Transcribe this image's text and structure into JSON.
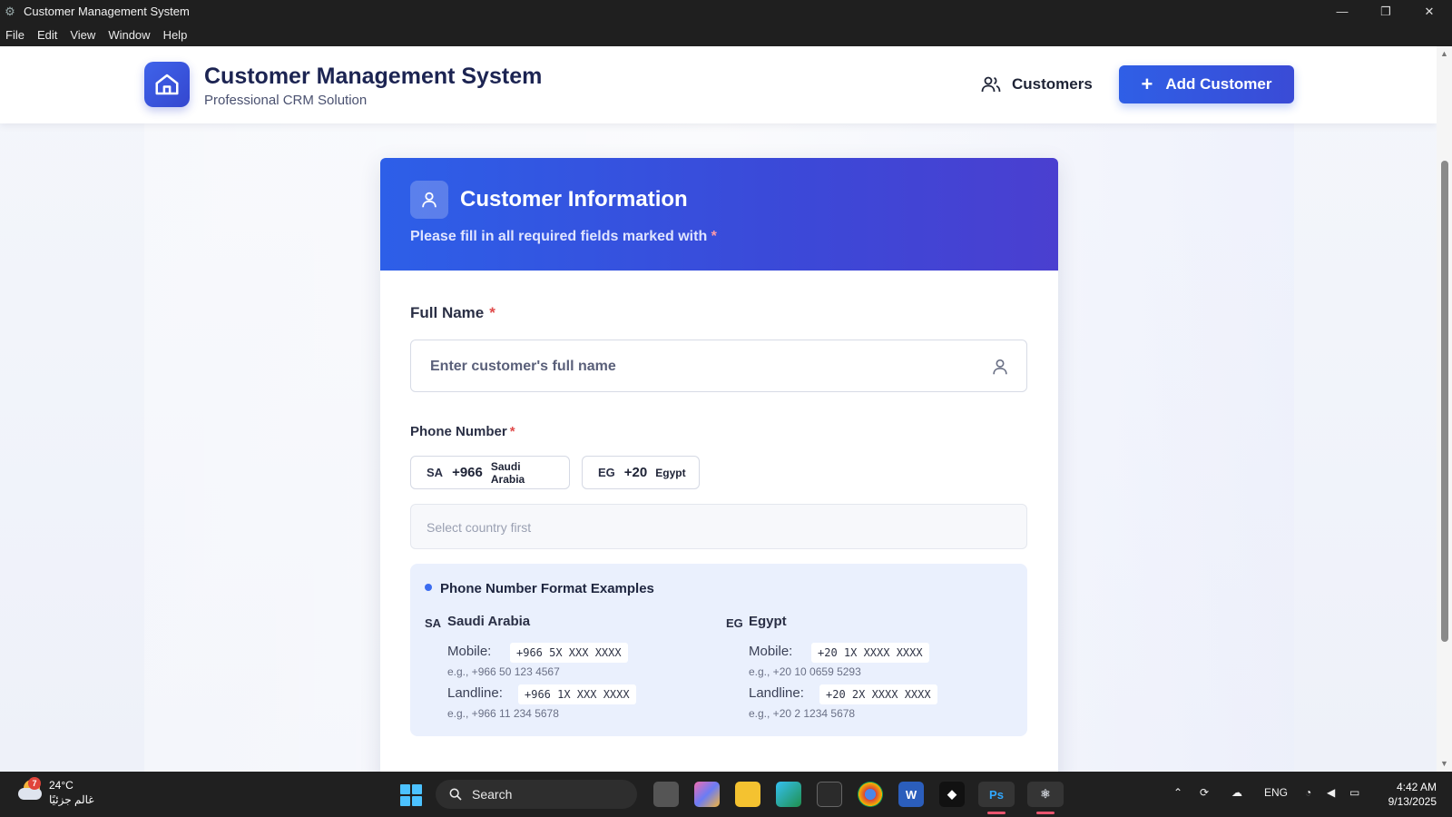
{
  "window": {
    "title": "Customer Management System",
    "menu": [
      "File",
      "Edit",
      "View",
      "Window",
      "Help"
    ]
  },
  "header": {
    "title": "Customer Management System",
    "subtitle": "Professional CRM Solution",
    "nav_customers": "Customers",
    "add_button": "Add Customer"
  },
  "form": {
    "title": "Customer Information",
    "note": "Please fill in all required fields marked with",
    "required_mark": "*",
    "full_name": {
      "label": "Full Name",
      "placeholder": "Enter customer's full name"
    },
    "phone": {
      "label": "Phone Number",
      "placeholder": "Select country first",
      "countries": [
        {
          "code": "SA",
          "dial": "+966",
          "name": "Saudi Arabia"
        },
        {
          "code": "EG",
          "dial": "+20",
          "name": "Egypt"
        }
      ]
    },
    "examples": {
      "title": "Phone Number Format Examples",
      "countries": [
        {
          "code": "SA",
          "name": "Saudi Arabia",
          "mobile_label": "Mobile:",
          "mobile_format": "+966 5X XXX XXXX",
          "mobile_example": "e.g., +966 50 123 4567",
          "landline_label": "Landline:",
          "landline_format": "+966 1X XXX XXXX",
          "landline_example": "e.g., +966 11 234 5678"
        },
        {
          "code": "EG",
          "name": "Egypt",
          "mobile_label": "Mobile:",
          "mobile_format": "+20 1X XXXX XXXX",
          "mobile_example": "e.g., +20 10 0659 5293",
          "landline_label": "Landline:",
          "landline_format": "+20 2X XXXX XXXX",
          "landline_example": "e.g., +20 2 1234 5678"
        }
      ]
    }
  },
  "taskbar": {
    "weather_temp": "24°C",
    "weather_desc": "غالم جزئيًا",
    "weather_badge": "7",
    "search_label": "Search",
    "language": "ENG",
    "time": "4:42 AM",
    "date": "9/13/2025"
  }
}
